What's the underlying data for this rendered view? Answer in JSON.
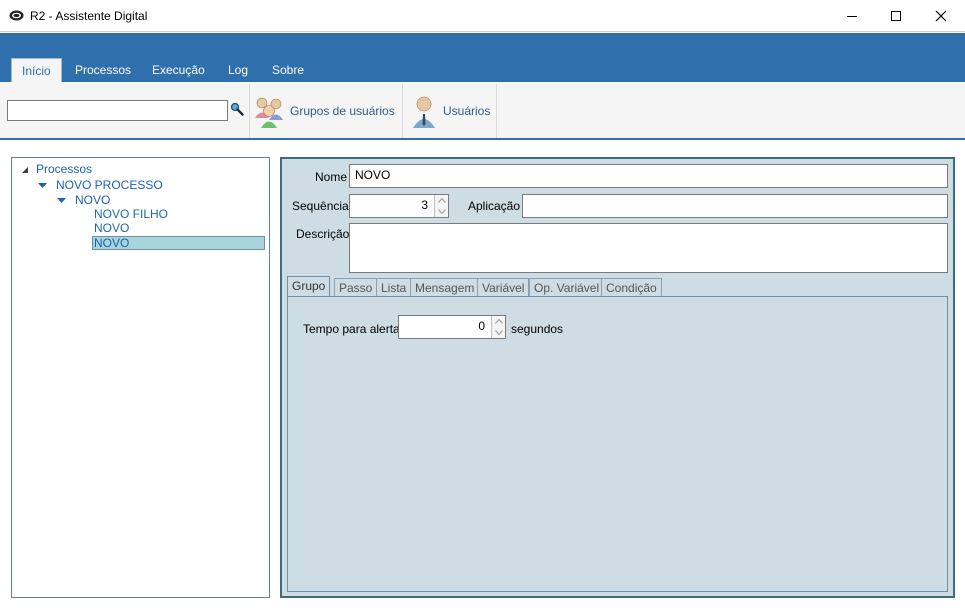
{
  "window": {
    "title": "R2 - Assistente Digital"
  },
  "ribbon": {
    "tabs": [
      {
        "label": "Início"
      },
      {
        "label": "Processos"
      },
      {
        "label": "Execução"
      },
      {
        "label": "Log"
      },
      {
        "label": "Sobre"
      }
    ],
    "search": {
      "value": "",
      "placeholder": ""
    },
    "groups_button": "Grupos de usuários",
    "users_button": "Usuários"
  },
  "tree": {
    "root": "Processos",
    "nodes": [
      {
        "label": "NOVO PROCESSO"
      },
      {
        "label": "NOVO"
      },
      {
        "label": "NOVO FILHO"
      },
      {
        "label": "NOVO"
      },
      {
        "label": "NOVO"
      }
    ]
  },
  "form": {
    "nome_label": "Nome",
    "nome_value": "NOVO",
    "sequencia_label": "Sequência",
    "sequencia_value": "3",
    "aplicacao_label": "Aplicação",
    "aplicacao_value": "",
    "descricao_label": "Descrição",
    "descricao_value": ""
  },
  "tabs": [
    {
      "label": "Grupo"
    },
    {
      "label": "Passo"
    },
    {
      "label": "Lista"
    },
    {
      "label": "Mensagem"
    },
    {
      "label": "Variável"
    },
    {
      "label": "Op. Variável"
    },
    {
      "label": "Condição"
    }
  ],
  "grupo_tab": {
    "tempo_label": "Tempo para alerta",
    "tempo_value": "0",
    "unit": "segundos"
  },
  "colors": {
    "accent": "#2e6fac",
    "panel_bg": "#cddde3",
    "selection": "#a9d4db",
    "tree_text": "#1a64b4"
  },
  "icons": {
    "app": "app-logo-icon",
    "search": "magnifier-icon",
    "groups": "users-group-icon",
    "users": "user-icon",
    "minimize": "minimize-icon",
    "maximize": "maximize-icon",
    "close": "close-icon"
  }
}
